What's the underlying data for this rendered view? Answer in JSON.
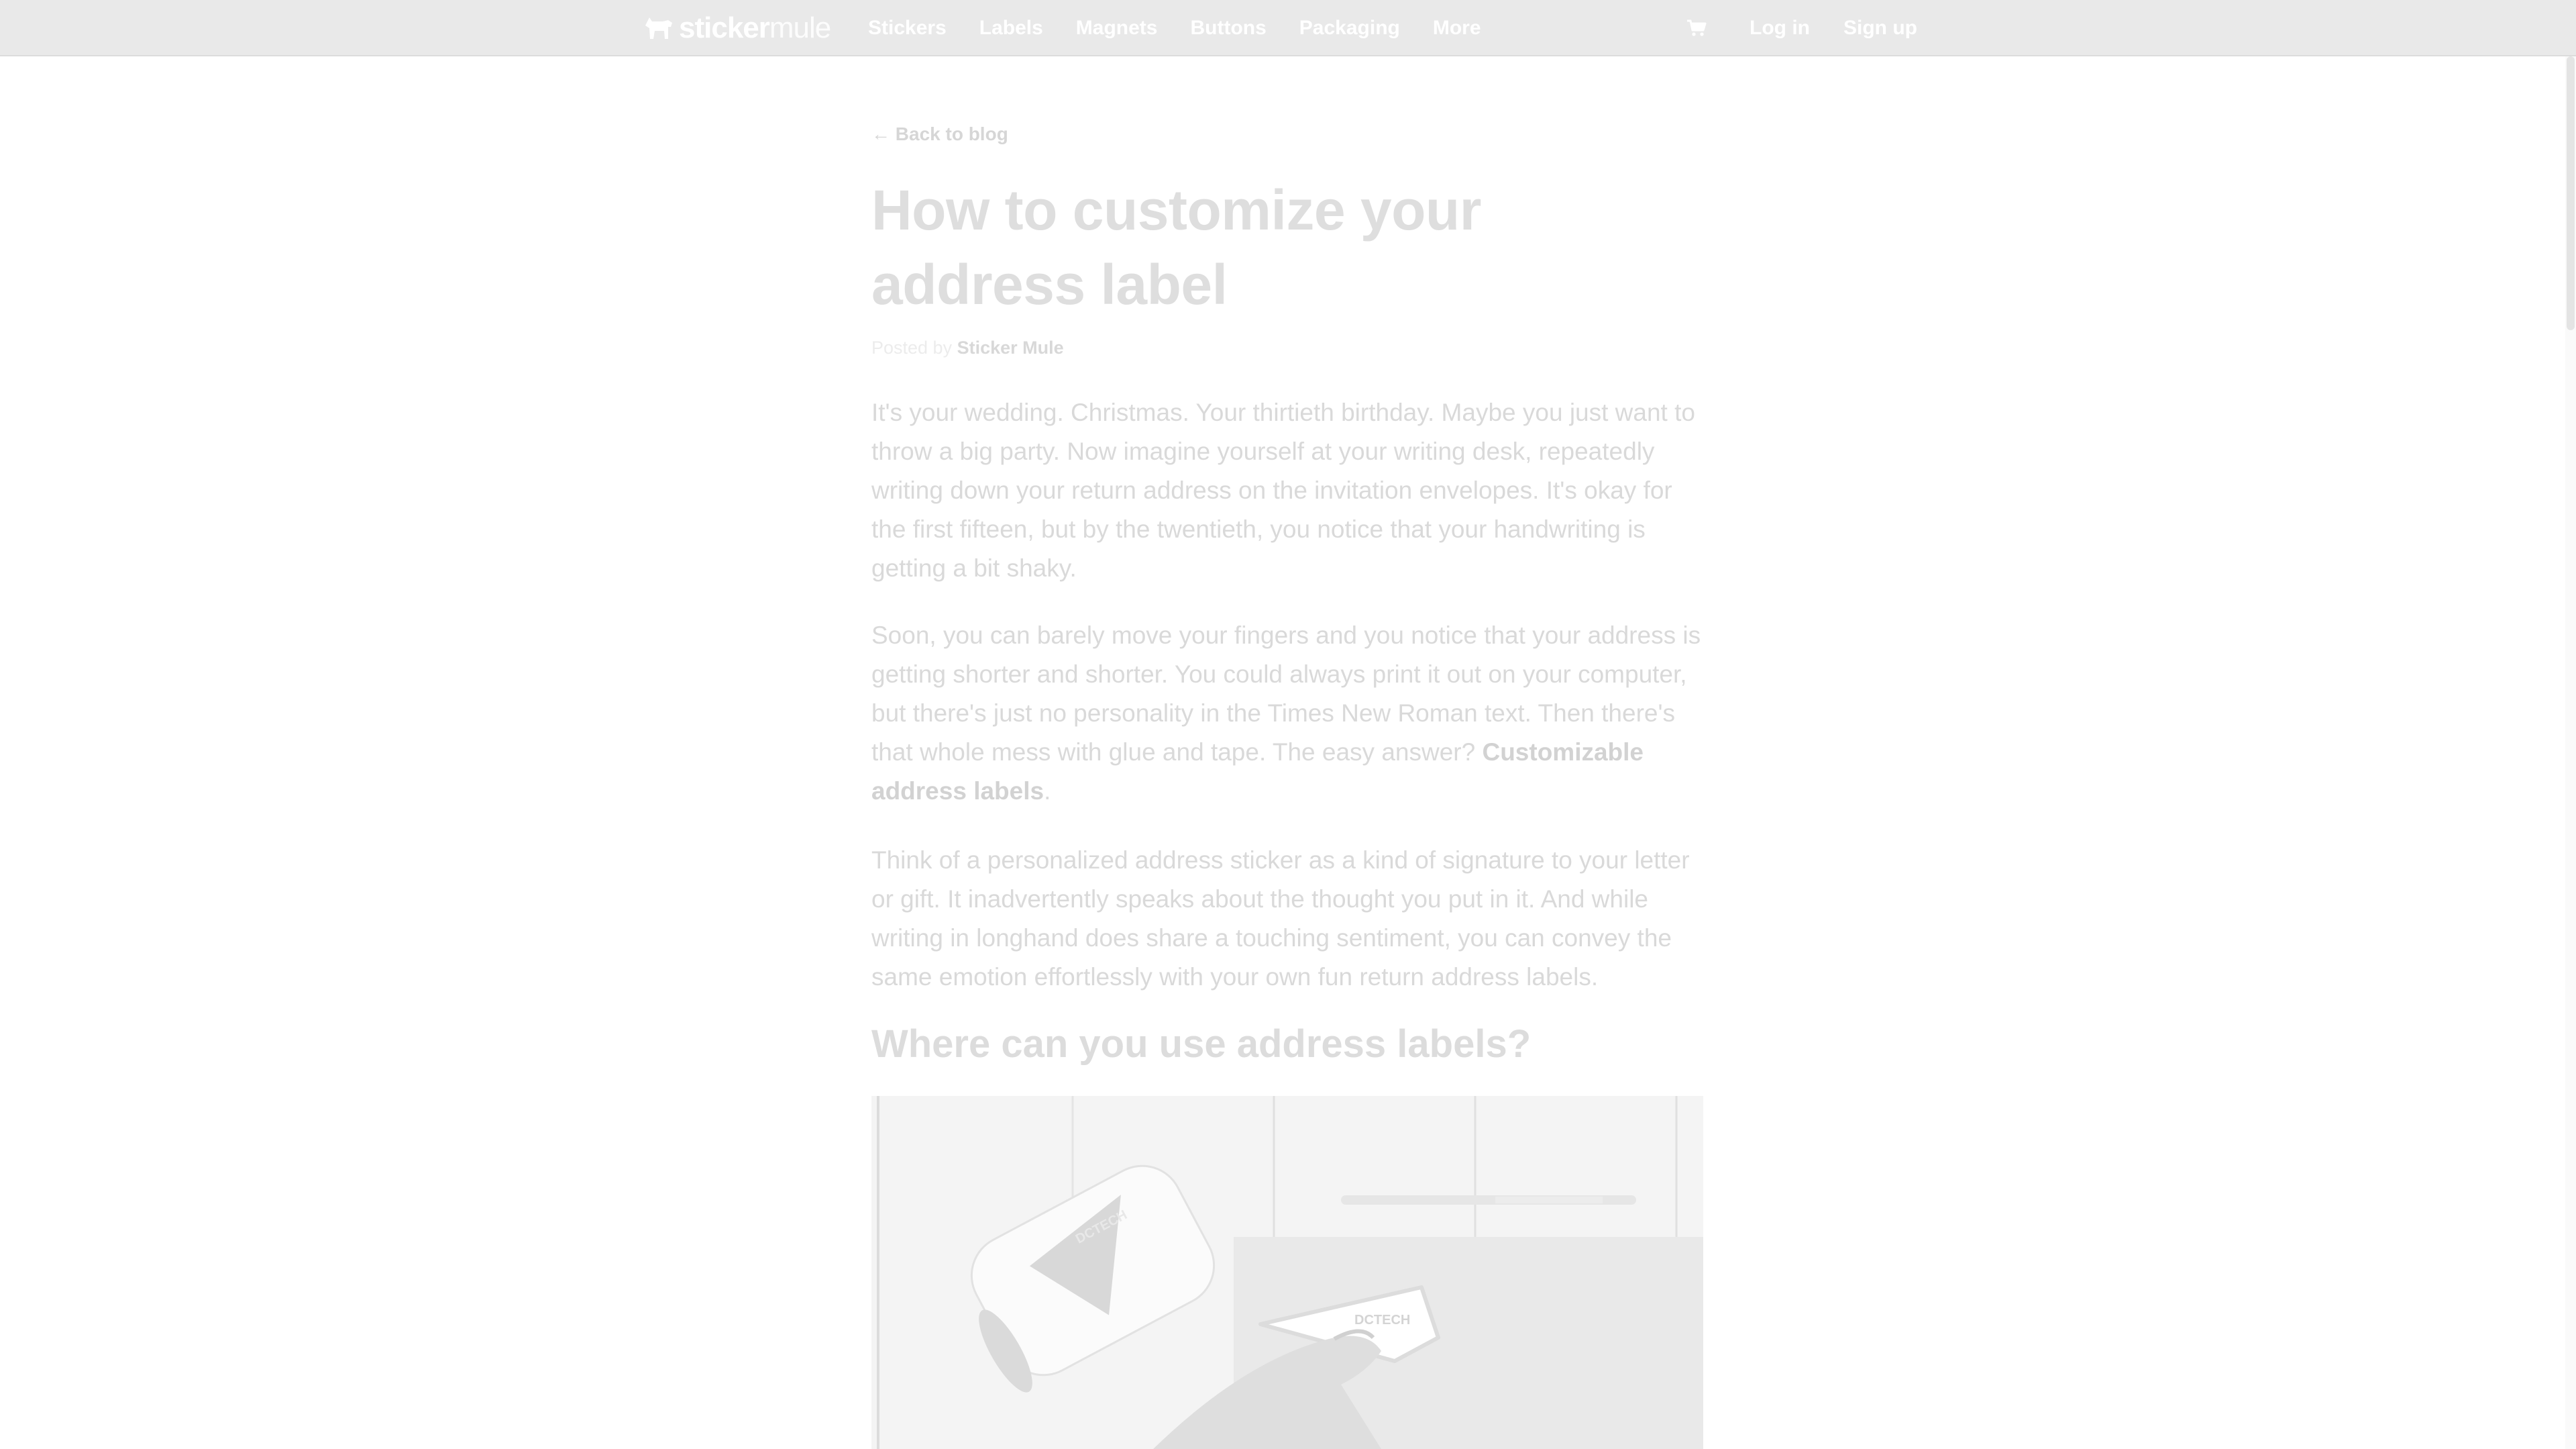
{
  "nav": {
    "logo_word_bold": "sticker",
    "logo_word_light": "mule",
    "items": [
      "Stickers",
      "Labels",
      "Magnets",
      "Buttons",
      "Packaging",
      "More"
    ],
    "cart_icon": "cart-icon",
    "login_label": "Log in",
    "signup_label": "Sign up"
  },
  "article": {
    "back_link": "← Back to blog",
    "title": "How to customize your address label",
    "meta_prefix": "Posted by",
    "meta_author": "Sticker Mule",
    "paragraphs": [
      "It's your wedding. Christmas. Your thirtieth birthday. Maybe you just want to throw a big party. Now imagine yourself at your writing desk, repeatedly writing down your return address on the invitation envelopes. It's okay for the first fifteen, but by the twentieth, you notice that your handwriting is getting a bit shaky.",
      "Soon, you can barely move your fingers and you notice that your address is getting shorter and shorter. You could always print it out on your computer, but there's just no personality in the Times New Roman text. Then there's that whole mess with glue and tape. The easy answer?",
      "Think of a personalized address sticker as a kind of signature to your letter or gift. It inadvertently speaks about the thought you put in it. And while writing in longhand does share a touching sentiment, you can convey the same emotion effortlessly with your own fun return address labels."
    ],
    "p2_link": "Customizable address labels",
    "p2_end": ".",
    "heading": "Where can you use address labels?",
    "sticker_text_1": "DCTECH",
    "sticker_text_2": "DCTECH"
  },
  "colors": {
    "nav_bg": "#e9e9e9",
    "nav_text": "#ffffff",
    "body_text": "#d9d9d9"
  }
}
